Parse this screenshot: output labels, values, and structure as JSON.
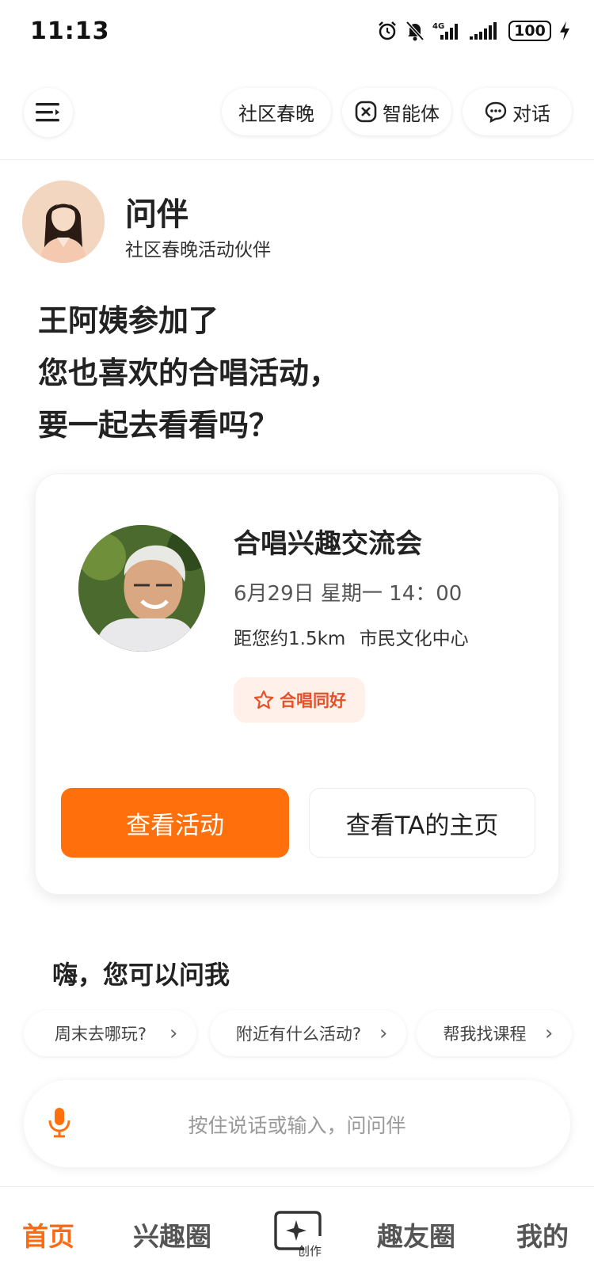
{
  "status_bar": {
    "time": "11:13",
    "battery": "100",
    "network": "4G"
  },
  "header": {
    "pills": {
      "gala": "社区春晚",
      "agent": "智能体",
      "chat": "对话"
    }
  },
  "assistant": {
    "name": "问伴",
    "subtitle": "社区春晚活动伙伴"
  },
  "headline": {
    "line1": "王阿姨参加了",
    "line2": "您也喜欢的合唱活动，",
    "line3": "要一起去看看吗？"
  },
  "activity": {
    "title": "合唱兴趣交流会",
    "time": "6月29日 星期一 14：00",
    "distance": "距您约1.5km",
    "venue": "市民文化中心",
    "tag": "合唱同好",
    "primary_button": "查看活动",
    "secondary_button": "查看TA的主页"
  },
  "suggestions": {
    "title": "嗨，您可以问我",
    "chips": [
      "周末去哪玩?",
      "附近有什么活动?",
      "帮我找课程"
    ]
  },
  "input": {
    "placeholder": "按住说话或输入，问问伴"
  },
  "tabbar": {
    "home": "首页",
    "interest": "兴趣圈",
    "create": "创作",
    "friends": "趣友圈",
    "me": "我的"
  },
  "colors": {
    "accent": "#ff6f0b",
    "tag_bg": "#fff1e9",
    "tag_text": "#e8502a"
  }
}
